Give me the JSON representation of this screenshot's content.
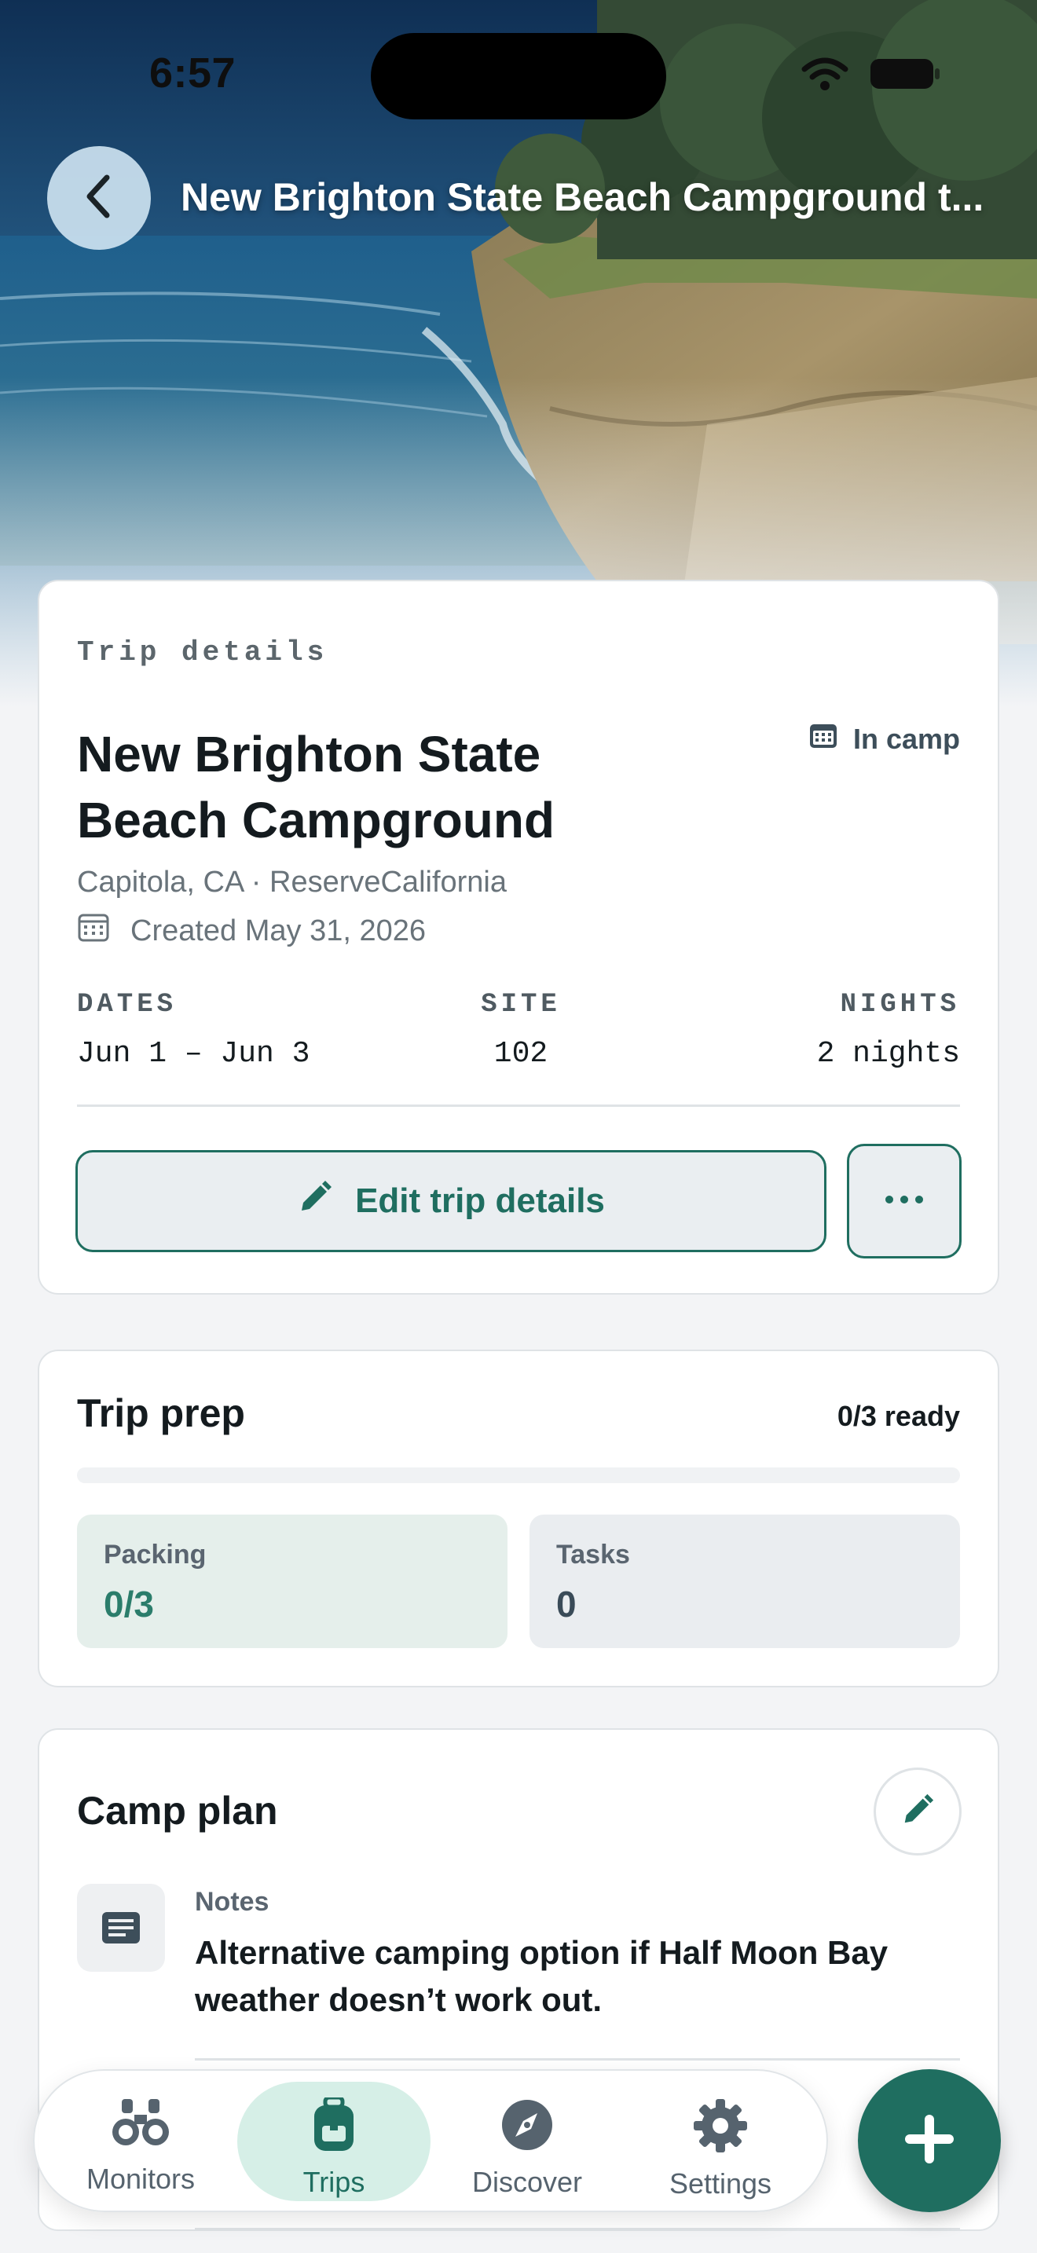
{
  "status_bar": {
    "time": "6:57"
  },
  "header": {
    "title": "New Brighton State Beach Campground t...",
    "back_icon": "chevron-left-icon"
  },
  "trip_details": {
    "eyebrow": "Trip details",
    "name": "New Brighton State Beach Campground",
    "status": "In camp",
    "location": "Capitola, CA · ReserveCalifornia",
    "created": "Created May 31, 2026",
    "meta": [
      {
        "label": "DATES",
        "value": "Jun 1 – Jun 3"
      },
      {
        "label": "SITE",
        "value": "102"
      },
      {
        "label": "NIGHTS",
        "value": "2 nights"
      }
    ],
    "edit_label": "Edit trip details"
  },
  "trip_prep": {
    "title": "Trip prep",
    "ready": "0/3 ready",
    "progress_fraction": 0,
    "tiles": [
      {
        "label": "Packing",
        "value": "0/3"
      },
      {
        "label": "Tasks",
        "value": "0"
      }
    ]
  },
  "camp_plan": {
    "title": "Camp plan",
    "note_label": "Notes",
    "note_text": "Alternative camping option if Half Moon Bay weather doesn’t work out."
  },
  "tabs": [
    {
      "label": "Monitors",
      "icon": "binoculars-icon",
      "active": false
    },
    {
      "label": "Trips",
      "icon": "backpack-icon",
      "active": true
    },
    {
      "label": "Discover",
      "icon": "compass-icon",
      "active": false
    },
    {
      "label": "Settings",
      "icon": "gear-icon",
      "active": false
    }
  ],
  "fab_icon": "plus-icon",
  "colors": {
    "accent": "#1f6e60",
    "background": "#f3f4f6",
    "tile_packing": "#e5efeb",
    "tab_active": "#d6efe7"
  }
}
